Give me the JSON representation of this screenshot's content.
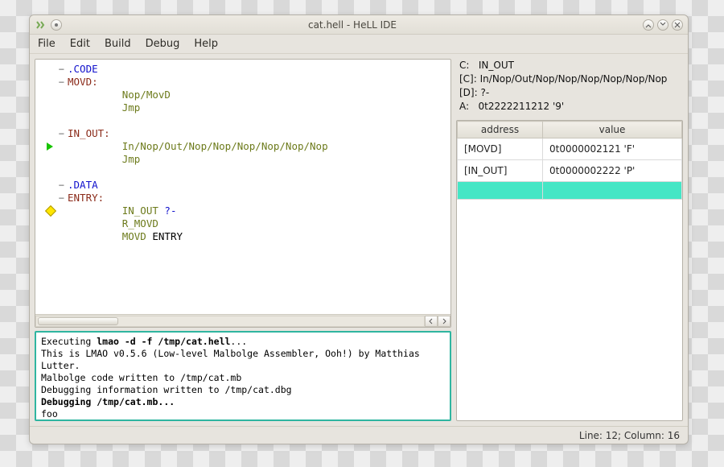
{
  "window": {
    "title": "cat.hell - HeLL IDE"
  },
  "menu": {
    "file": "File",
    "edit": "Edit",
    "build": "Build",
    "debug": "Debug",
    "help": "Help"
  },
  "code": {
    "l1": ".CODE",
    "l2_label": "MOVD:",
    "l3": "Nop/MovD",
    "l4": "Jmp",
    "l6_label": "IN_OUT:",
    "l7": "In/Nop/Out/Nop/Nop/Nop/Nop/Nop/Nop",
    "l8": "Jmp",
    "l10": ".DATA",
    "l11_label": "ENTRY:",
    "l12_a": "IN_OUT ",
    "l12_b": "?-",
    "l13": "R_MOVD",
    "l14_a": "MOVD",
    "l14_b": " ENTRY"
  },
  "registers": {
    "c_label": "C:",
    "c_val": "IN_OUT",
    "c_deref_label": "[C]:",
    "c_deref_val": "In/Nop/Out/Nop/Nop/Nop/Nop/Nop/Nop",
    "d_deref_label": "[D]:",
    "d_deref_val": "?-",
    "a_label": "A:",
    "a_val": "0t2222211212 '9'"
  },
  "memory": {
    "col_addr": "address",
    "col_val": "value",
    "rows": [
      {
        "addr": "[MOVD]",
        "val": "0t0000002121 'F'"
      },
      {
        "addr": "[IN_OUT]",
        "val": "0t0000002222 'P'"
      }
    ]
  },
  "console": {
    "l1a": "Executing ",
    "l1b": "lmao -d -f /tmp/cat.hell",
    "l1c": "...",
    "l2": "This is LMAO v0.5.6 (Low-level Malbolge Assembler, Ooh!) by Matthias Lutter.",
    "l3": "Malbolge code written to /tmp/cat.mb",
    "l4": "Debugging information written to /tmp/cat.dbg",
    "l5a": "Debugging ",
    "l5b": "/tmp/cat.mb",
    "l5c": "...",
    "l6": "foo"
  },
  "status": {
    "pos": "Line: 12; Column: 16"
  }
}
